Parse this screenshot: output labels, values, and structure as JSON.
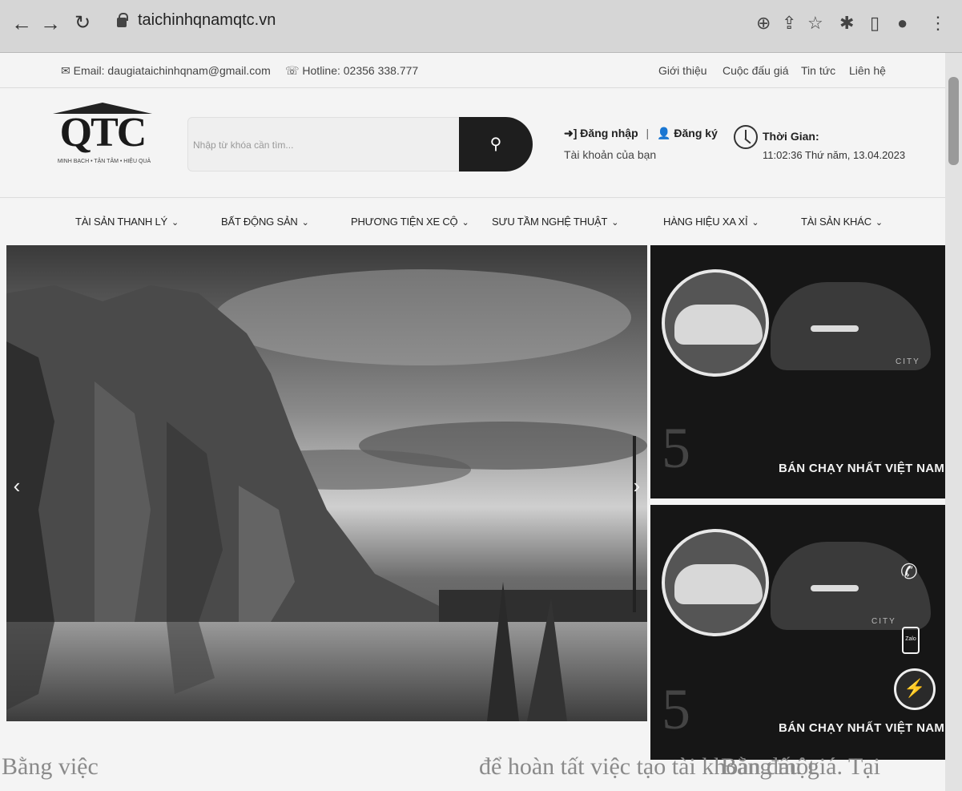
{
  "browser": {
    "url": "taichinhqnamqtc.vn",
    "icons": [
      "back-icon",
      "forward-icon",
      "reload-icon",
      "lock-icon",
      "zoom-icon",
      "share-icon",
      "star-icon",
      "extensions-icon",
      "sidepanel-icon",
      "profile-icon",
      "menu-icon"
    ]
  },
  "topbar": {
    "email": "Email: daugiataichinhqnam@gmail.com",
    "hotline": "Hotline: 02356 338.777",
    "links": [
      "Giới thiệu",
      "Cuộc đấu giá",
      "Tin tức",
      "Liên hệ"
    ]
  },
  "logo": {
    "letters": "QTC",
    "tagline": "MINH BẠCH • TẬN TÂM • HIỆU QUẢ"
  },
  "search": {
    "placeholder": "Nhập từ khóa cần tìm..."
  },
  "account": {
    "login": "Đăng nhập",
    "register": "Đăng ký",
    "subtitle": "Tài khoản của bạn"
  },
  "time": {
    "label": "Thời Gian:",
    "value": "11:02:36 Thứ năm, 13.04.2023"
  },
  "nav": [
    "TÀI SẢN THANH LÝ",
    "BẤT ĐỘNG SẢN",
    "PHƯƠNG TIỆN XE CỘ",
    "SƯU TẦM NGHỆ THUẬT",
    "HÀNG HIỆU XA XỈ",
    "TÀI SẢN KHÁC"
  ],
  "banners": [
    {
      "number": "5",
      "caption": "BÁN CHẠY NHẤT VIỆT NAM",
      "car_label": "CITY"
    },
    {
      "number": "5",
      "caption": "BÁN CHẠY NHẤT VIỆT NAM",
      "car_label": "CITY"
    }
  ],
  "bottom": {
    "left": "Bằng việc",
    "middle": "để hoàn tất việc tạo tài khoản đấu giá. Tại",
    "right": "Bằng một"
  }
}
